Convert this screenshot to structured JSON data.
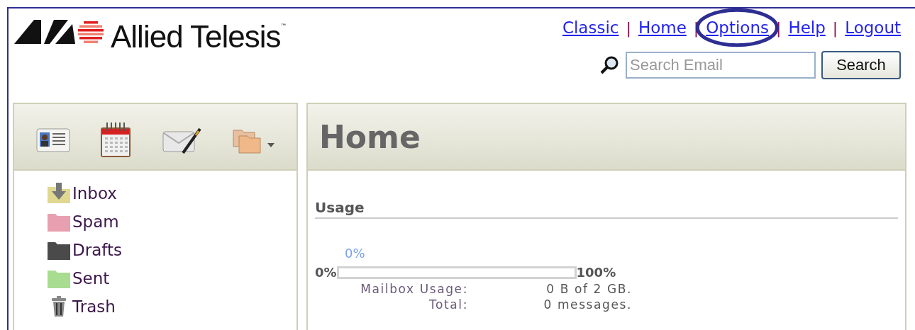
{
  "logo": {
    "name": "Allied Telesis",
    "mark": "™"
  },
  "nav_links": [
    {
      "label": "Classic",
      "highlighted": false
    },
    {
      "label": "Home",
      "highlighted": false
    },
    {
      "label": "Options",
      "highlighted": true
    },
    {
      "label": "Help",
      "highlighted": false
    },
    {
      "label": "Logout",
      "highlighted": false
    }
  ],
  "nav_separators": [
    "|",
    "|",
    "|",
    "|"
  ],
  "search": {
    "placeholder": "Search Email",
    "button": "Search"
  },
  "toolbar": [
    {
      "kind": "contacts",
      "dropdown": false
    },
    {
      "kind": "calendar",
      "dropdown": false
    },
    {
      "kind": "compose",
      "dropdown": false
    },
    {
      "kind": "folders",
      "dropdown": true
    }
  ],
  "folders": [
    {
      "label": "Inbox",
      "kind": "inbox",
      "color": "#e0d890"
    },
    {
      "label": "Spam",
      "kind": "folder",
      "color": "#e8a0b0"
    },
    {
      "label": "Drafts",
      "kind": "folder",
      "color": "#4a4a4a"
    },
    {
      "label": "Sent",
      "kind": "folder",
      "color": "#a8dc90"
    },
    {
      "label": "Trash",
      "kind": "trash",
      "color": "#888888"
    }
  ],
  "main": {
    "title": "Home",
    "section": "Usage",
    "usage": {
      "reading": "0%",
      "min_label": "0%",
      "max_label": "100%",
      "rows": [
        {
          "label": "Mailbox Usage:",
          "value": "0 B of 2 GB."
        },
        {
          "label": "Total:",
          "value": "0 messages."
        }
      ]
    }
  }
}
